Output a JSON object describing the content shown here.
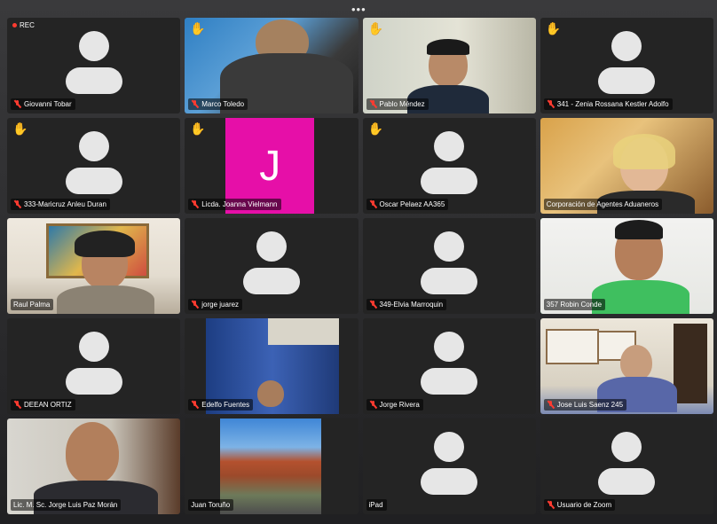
{
  "window": {
    "menu_dots": "•••",
    "rec_label": "REC"
  },
  "tiles": [
    {
      "name": "Giovanni Tobar",
      "muted": true,
      "hand": false,
      "video": false,
      "rec": true
    },
    {
      "name": "Marco Toledo",
      "muted": true,
      "hand": true,
      "video": true
    },
    {
      "name": "Pablo Méndez",
      "muted": true,
      "hand": true,
      "video": true
    },
    {
      "name": "341 - Zenia Rossana Kestler Adolfo",
      "muted": true,
      "hand": true,
      "video": false
    },
    {
      "name": "333-Maricruz Anleu Duran",
      "muted": true,
      "hand": true,
      "video": false
    },
    {
      "name": "Licda. Joanna Vielmann",
      "muted": true,
      "hand": true,
      "video": false,
      "initial": "J"
    },
    {
      "name": "Oscar Pelaez AA365",
      "muted": true,
      "hand": true,
      "video": false
    },
    {
      "name": "Corporación de Agentes Aduaneros",
      "muted": false,
      "hand": false,
      "video": true
    },
    {
      "name": "Raul Palma",
      "muted": false,
      "hand": false,
      "video": true
    },
    {
      "name": "jorge juarez",
      "muted": true,
      "hand": false,
      "video": false
    },
    {
      "name": "349-Elvia Marroquin",
      "muted": true,
      "hand": false,
      "video": false
    },
    {
      "name": "357 Robin Conde",
      "muted": false,
      "hand": false,
      "video": true,
      "active": true
    },
    {
      "name": "DEEAN ORTIZ",
      "muted": true,
      "hand": false,
      "video": false
    },
    {
      "name": "Edelfo Fuentes",
      "muted": true,
      "hand": false,
      "video": true
    },
    {
      "name": "Jorge Rivera",
      "muted": true,
      "hand": false,
      "video": false
    },
    {
      "name": "Jose Luis Saenz  245",
      "muted": true,
      "hand": false,
      "video": true
    },
    {
      "name": "Lic. M. Sc. Jorge Luis Paz Morán",
      "muted": false,
      "hand": false,
      "video": true
    },
    {
      "name": "Juan Toruño",
      "muted": false,
      "hand": false,
      "video": true
    },
    {
      "name": "iPad",
      "muted": false,
      "hand": false,
      "video": false
    },
    {
      "name": "Usuario de Zoom",
      "muted": true,
      "hand": false,
      "video": false
    }
  ],
  "colors": {
    "mute_red": "#ff3b30",
    "active_speaker": "#21c25b",
    "raise_hand": "#f5c518",
    "initial_bg": "#e60fa8"
  },
  "icons": {
    "muted": "mic-off-icon",
    "hand": "raise-hand-icon",
    "avatar": "avatar-placeholder-icon",
    "menu": "more-dots-icon"
  }
}
